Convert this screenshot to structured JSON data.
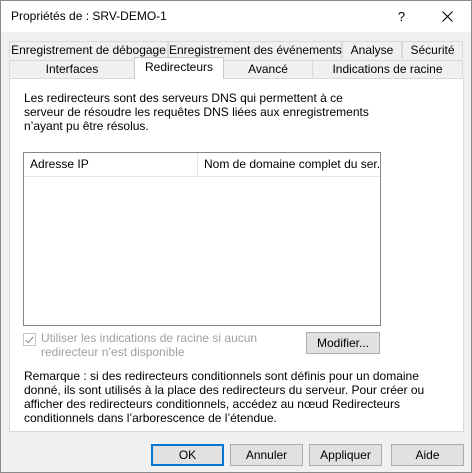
{
  "window": {
    "title": "Propriétés de : SRV-DEMO-1",
    "help_glyph": "?",
    "close_icon": "close-icon"
  },
  "tabs": {
    "row_top": [
      {
        "label": "Enregistrement de débogage"
      },
      {
        "label": "Enregistrement des événements"
      },
      {
        "label": "Analyse"
      },
      {
        "label": "Sécurité"
      }
    ],
    "row_bottom": [
      {
        "label": "Interfaces"
      },
      {
        "label": "Redirecteurs",
        "active": true
      },
      {
        "label": "Avancé"
      },
      {
        "label": "Indications de racine"
      }
    ]
  },
  "panel": {
    "description": "Les redirecteurs sont des serveurs DNS qui permettent à ce serveur de résoudre les requêtes DNS liées aux enregistrements n’ayant pu être résolus.",
    "list": {
      "columns": [
        {
          "label": "Adresse IP"
        },
        {
          "label": "Nom de domaine complet du ser..."
        }
      ],
      "rows": []
    },
    "checkbox": {
      "label": "Utiliser les indications de racine si aucun redirecteur n’est disponible",
      "checked": true,
      "disabled": true
    },
    "modify_label": "Modifier...",
    "note": "Remarque : si des redirecteurs conditionnels sont définis pour un domaine donné, ils sont utilisés à la place des redirecteurs du serveur. Pour créer ou afficher des redirecteurs conditionnels, accédez au nœud Redirecteurs conditionnels dans l’arborescence de l’étendue."
  },
  "buttons": {
    "ok": "OK",
    "cancel": "Annuler",
    "apply": "Appliquer",
    "help": "Aide"
  },
  "colors": {
    "accent": "#0078d7",
    "disabled_text": "#a0a0a0"
  }
}
